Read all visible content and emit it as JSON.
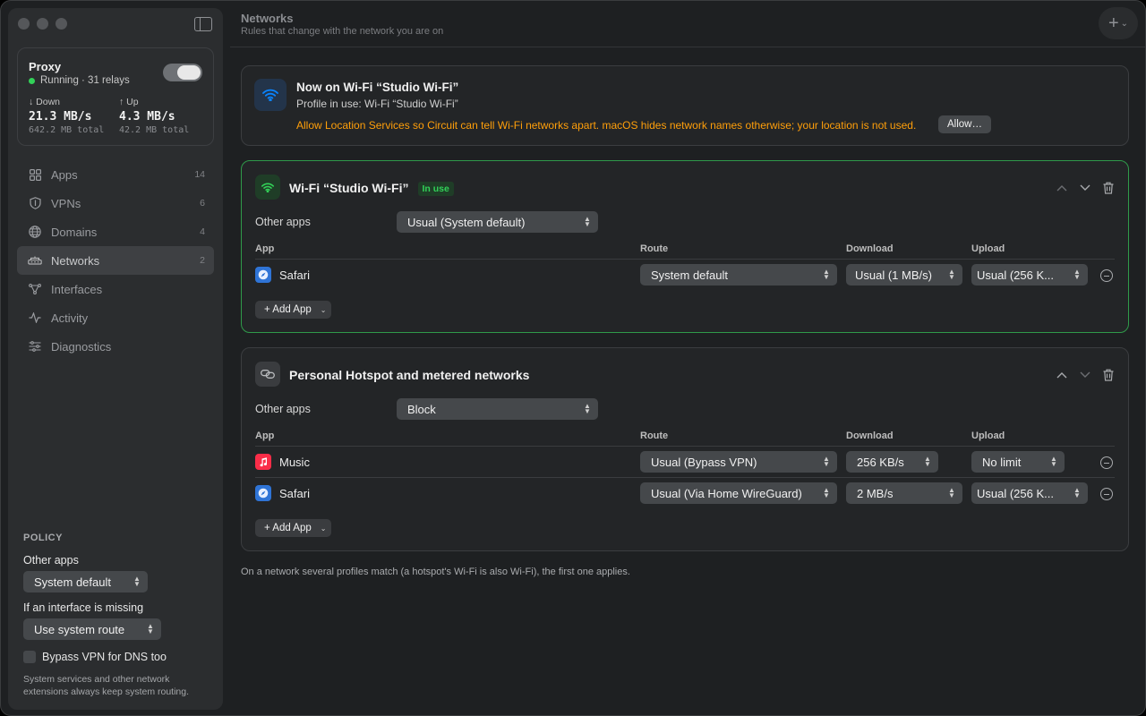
{
  "sidebar": {
    "proxy": {
      "title": "Proxy",
      "status": "Running · 31 relays",
      "enabled": true,
      "down": {
        "label": "↓ Down",
        "value": "21.3 MB/s",
        "total": "642.2 MB total"
      },
      "up": {
        "label": "↑ Up",
        "value": "4.3 MB/s",
        "total": "42.2 MB total"
      }
    },
    "nav": [
      {
        "label": "Apps",
        "count": "14",
        "icon": "apps-grid-icon"
      },
      {
        "label": "VPNs",
        "count": "6",
        "icon": "shield-icon"
      },
      {
        "label": "Domains",
        "count": "4",
        "icon": "globe-icon"
      },
      {
        "label": "Networks",
        "count": "2",
        "icon": "network-icon",
        "active": true
      },
      {
        "label": "Interfaces",
        "count": "",
        "icon": "interfaces-icon"
      },
      {
        "label": "Activity",
        "count": "",
        "icon": "activity-icon"
      },
      {
        "label": "Diagnostics",
        "count": "",
        "icon": "sliders-icon"
      }
    ],
    "policy": {
      "heading": "POLICY",
      "other_apps_label": "Other apps",
      "other_apps_value": "System default",
      "missing_label": "If an interface is missing",
      "missing_value": "Use system route",
      "bypass_dns_label": "Bypass VPN for DNS too",
      "bypass_dns_checked": false,
      "note": "System services and other network extensions always keep system routing."
    }
  },
  "header": {
    "title": "Networks",
    "subtitle": "Rules that change with the network you are on",
    "add_icon": "plus-icon"
  },
  "status": {
    "title": "Now on Wi-Fi “Studio Wi-Fi”",
    "profile": "Profile in use: Wi-Fi “Studio Wi-Fi”",
    "warning": "Allow Location Services so Circuit can tell Wi-Fi networks apart. macOS hides network names otherwise; your location is not used.",
    "allow_label": "Allow…",
    "warning_color": "#ff9f0a"
  },
  "profiles": [
    {
      "title": "Wi-Fi “Studio Wi-Fi”",
      "badge": "In use",
      "other_apps_label": "Other apps",
      "other_apps_value": "Usual (System default)",
      "columns": {
        "app": "App",
        "route": "Route",
        "download": "Download",
        "upload": "Upload"
      },
      "rows": [
        {
          "app": "Safari",
          "icon": "safari-icon",
          "route": "System default",
          "download": "Usual (1 MB/s)",
          "upload": "Usual (256 K..."
        }
      ],
      "add_app_label": "+ Add App"
    },
    {
      "title": "Personal Hotspot and metered networks",
      "badge": "",
      "other_apps_label": "Other apps",
      "other_apps_value": "Block",
      "columns": {
        "app": "App",
        "route": "Route",
        "download": "Download",
        "upload": "Upload"
      },
      "rows": [
        {
          "app": "Music",
          "icon": "music-icon",
          "route": "Usual (Bypass VPN)",
          "download": "256 KB/s",
          "upload": "No limit"
        },
        {
          "app": "Safari",
          "icon": "safari-icon",
          "route": "Usual (Via Home WireGuard)",
          "download": "2 MB/s",
          "upload": "Usual (256 K..."
        }
      ],
      "add_app_label": "+ Add App"
    }
  ],
  "footnote": "On a network several profiles match (a hotspot's Wi-Fi is also Wi-Fi), the first one applies.",
  "colors": {
    "accent_green": "#32d158",
    "selected_border": "#2f9a4a",
    "wifi_blue": "#0a84ff"
  }
}
